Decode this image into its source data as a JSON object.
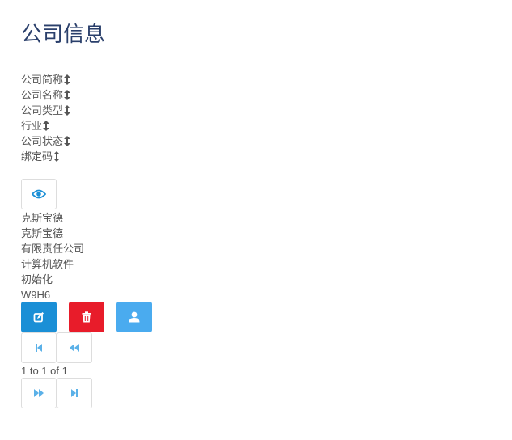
{
  "page": {
    "title": "公司信息"
  },
  "table": {
    "headers": [
      {
        "label": "公司简称",
        "icon": "sort-icon"
      },
      {
        "label": "公司名称",
        "icon": "sort-icon"
      },
      {
        "label": "公司类型",
        "icon": "sort-icon"
      },
      {
        "label": "行业",
        "icon": "sort-icon"
      },
      {
        "label": "公司状态",
        "icon": "sort-icon"
      },
      {
        "label": "绑定码",
        "icon": "sort-icon"
      }
    ],
    "view_button_icon": "eye-icon",
    "row": {
      "short_name": "克斯宝德",
      "full_name": "克斯宝德",
      "company_type": "有限责任公司",
      "industry": "计算机软件",
      "status": "初始化",
      "bind_code": "W9H6"
    },
    "actions": [
      {
        "name": "edit",
        "icon": "edit-icon",
        "color": "#1a8fd6"
      },
      {
        "name": "delete",
        "icon": "trash-icon",
        "color": "#e81c2a"
      },
      {
        "name": "user",
        "icon": "user-icon",
        "color": "#4aabef"
      }
    ]
  },
  "pagination": {
    "info": "1 to 1 of 1",
    "icons": [
      "first-page-icon",
      "previous-page-icon",
      "next-page-icon",
      "last-page-icon"
    ],
    "icon_color": "#5bb1e8"
  },
  "colors": {
    "title": "#2a3f6b",
    "text": "#555555",
    "border": "#dddddd"
  }
}
